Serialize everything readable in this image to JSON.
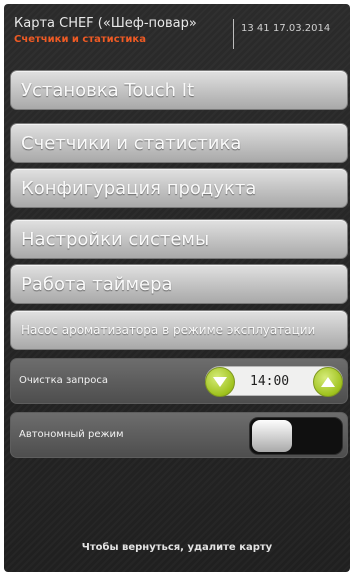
{
  "header": {
    "title": "Карта CHEF («Шеф-повар»",
    "subtitle": "Счетчики и статистика",
    "time": "13 41",
    "date": "17.03.2014"
  },
  "menu": [
    {
      "label": "Установка Touch It"
    },
    {
      "label": "Счетчики и статистика"
    },
    {
      "label": "Конфигурация продукта"
    },
    {
      "label": "Настройки системы"
    },
    {
      "label": "Работа таймера"
    },
    {
      "label": "Насос ароматизатора в режиме эксплуатации"
    }
  ],
  "request_clean": {
    "label": "Очистка запроса",
    "value": "14:00"
  },
  "autonomous": {
    "label": "Автономный режим",
    "state": "off"
  },
  "footer": {
    "text": "Чтобы вернуться, удалите карту"
  },
  "colors": {
    "accent_orange": "#ef5a24",
    "stepper_green": "#9fc21d"
  }
}
